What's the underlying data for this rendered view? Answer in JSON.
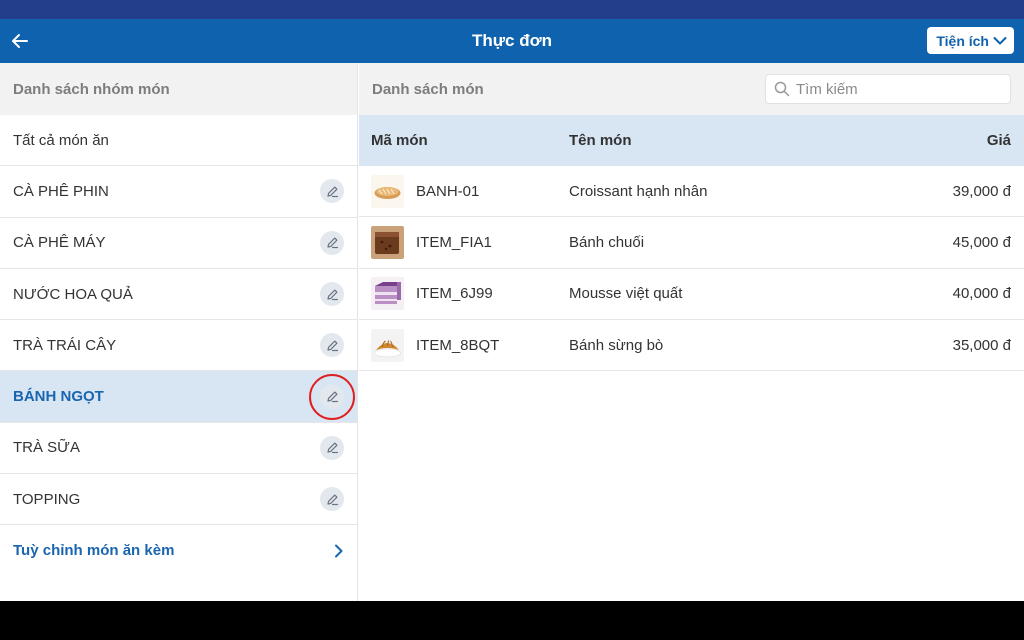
{
  "header": {
    "title": "Thực đơn",
    "utility_label": "Tiện ích",
    "colors": {
      "status": "#233f8c",
      "bar": "#0f62ad"
    }
  },
  "left_panel": {
    "title": "Danh sách nhóm món",
    "groups": [
      {
        "label": "Tất cả món ăn",
        "editable": false,
        "selected": false
      },
      {
        "label": "CÀ PHÊ PHIN",
        "editable": true,
        "selected": false
      },
      {
        "label": "CÀ PHÊ MÁY",
        "editable": true,
        "selected": false
      },
      {
        "label": "NƯỚC HOA QUẢ",
        "editable": true,
        "selected": false
      },
      {
        "label": "TRÀ TRÁI CÂY",
        "editable": true,
        "selected": false
      },
      {
        "label": "BÁNH NGỌT",
        "editable": true,
        "selected": true
      },
      {
        "label": "TRÀ SỮA",
        "editable": true,
        "selected": false
      },
      {
        "label": "TOPPING",
        "editable": true,
        "selected": false
      }
    ],
    "custom_label": "Tuỳ chỉnh món ăn kèm"
  },
  "right_panel": {
    "title": "Danh sách món",
    "search_placeholder": "Tìm kiếm",
    "columns": {
      "code": "Mã món",
      "name": "Tên món",
      "price": "Giá"
    },
    "items": [
      {
        "code": "BANH-01",
        "name": "Croissant hạnh nhân",
        "price": "39,000 đ",
        "thumb": "croissant-almond"
      },
      {
        "code": "ITEM_FIA1",
        "name": "Bánh chuối",
        "price": "45,000 đ",
        "thumb": "banana-cake"
      },
      {
        "code": "ITEM_6J99",
        "name": "Mousse việt quất",
        "price": "40,000 đ",
        "thumb": "blueberry-mousse"
      },
      {
        "code": "ITEM_8BQT",
        "name": "Bánh sừng bò",
        "price": "35,000 đ",
        "thumb": "croissant"
      }
    ]
  },
  "accent_color": "#1a65b0",
  "selected_color": "#d8e6f4"
}
